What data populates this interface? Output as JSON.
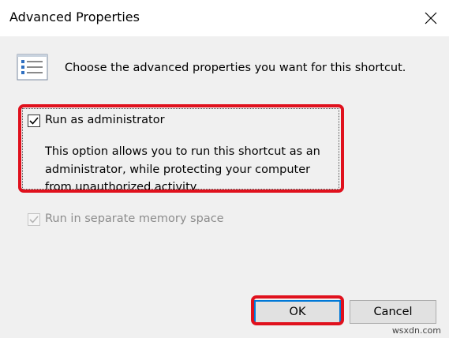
{
  "window": {
    "title": "Advanced Properties"
  },
  "intro_text": "Choose the advanced properties you want for this shortcut.",
  "options": {
    "run_as_admin": {
      "label": "Run as administrator",
      "checked": true,
      "description": "This option allows you to run this shortcut as an administrator, while protecting your computer from unauthorized activity."
    },
    "separate_memory": {
      "label": "Run in separate memory space",
      "checked": true,
      "enabled": false
    }
  },
  "buttons": {
    "ok": "OK",
    "cancel": "Cancel"
  },
  "watermark": "wsxdn.com",
  "icons": {
    "close": "close-icon",
    "header": "properties-list-icon"
  },
  "colors": {
    "highlight": "#e0111d",
    "focus_border": "#0078d7",
    "disabled_text": "#8c8c8c"
  }
}
